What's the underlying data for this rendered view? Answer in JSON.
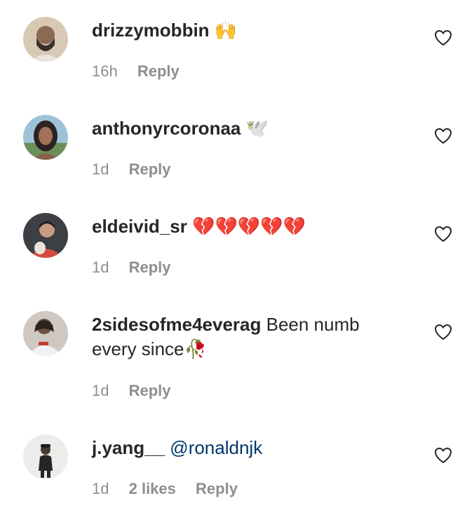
{
  "comments": [
    {
      "username": "drizzymobbin",
      "body": "",
      "emoji": "🙌",
      "mention": "",
      "time": "16h",
      "likes": "",
      "reply": "Reply"
    },
    {
      "username": "anthonyrcoronaa",
      "body": "",
      "emoji": "🕊️",
      "mention": "",
      "time": "1d",
      "likes": "",
      "reply": "Reply"
    },
    {
      "username": "eldeivid_sr",
      "body": "",
      "emoji": "💔💔💔💔💔",
      "mention": "",
      "time": "1d",
      "likes": "",
      "reply": "Reply"
    },
    {
      "username": "2sidesofme4everag",
      "body": "Been numb every since",
      "emoji": "🥀",
      "mention": "",
      "time": "1d",
      "likes": "",
      "reply": "Reply"
    },
    {
      "username": "j.yang__",
      "body": "",
      "emoji": "",
      "mention": "@ronaldnjk",
      "time": "1d",
      "likes": "2 likes",
      "reply": "Reply"
    }
  ],
  "icons": {
    "like": "heart-outline-icon"
  },
  "colors": {
    "text": "#262626",
    "meta": "#8e8e8e",
    "mention": "#00376b",
    "background": "#ffffff"
  }
}
